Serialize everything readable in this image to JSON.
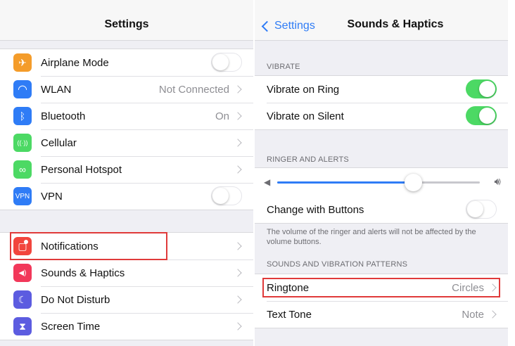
{
  "left": {
    "title": "Settings",
    "group1": [
      {
        "label": "Airplane Mode",
        "icon": "airplane-icon",
        "color": "#f49c2a",
        "accessory": "toggle-off"
      },
      {
        "label": "WLAN",
        "icon": "wifi-icon",
        "color": "#2f7cf6",
        "detail": "Not Connected",
        "accessory": "chevron"
      },
      {
        "label": "Bluetooth",
        "icon": "bluetooth-icon",
        "color": "#2f7cf6",
        "detail": "On",
        "accessory": "chevron"
      },
      {
        "label": "Cellular",
        "icon": "antenna-icon",
        "color": "#4cd964",
        "accessory": "chevron"
      },
      {
        "label": "Personal Hotspot",
        "icon": "hotspot-link-icon",
        "color": "#4cd964",
        "accessory": "chevron"
      },
      {
        "label": "VPN",
        "icon": "vpn-icon",
        "icon_text": "VPN",
        "color": "#2f7cf6",
        "accessory": "toggle-off"
      }
    ],
    "group2": [
      {
        "label": "Notifications",
        "icon": "notifications-icon",
        "color": "#f2453d",
        "accessory": "chevron"
      },
      {
        "label": "Sounds & Haptics",
        "icon": "speaker-icon",
        "color": "#f2385a",
        "accessory": "chevron"
      },
      {
        "label": "Do Not Disturb",
        "icon": "moon-icon",
        "color": "#5c5ce0",
        "accessory": "chevron"
      },
      {
        "label": "Screen Time",
        "icon": "hourglass-icon",
        "color": "#5c5ce0",
        "accessory": "chevron"
      }
    ]
  },
  "right": {
    "back_label": "Settings",
    "title": "Sounds & Haptics",
    "vibrate_header": "VIBRATE",
    "vibrate_on_ring": "Vibrate on Ring",
    "vibrate_on_silent": "Vibrate on Silent",
    "ringer_header": "RINGER AND ALERTS",
    "ringer_volume": 0.67,
    "change_with_buttons": "Change with Buttons",
    "ringer_note": "The volume of the ringer and alerts will not be affected by the volume buttons.",
    "patterns_header": "SOUNDS AND VIBRATION PATTERNS",
    "ringtone_label": "Ringtone",
    "ringtone_value": "Circles",
    "text_tone_label": "Text Tone",
    "text_tone_value": "Note"
  },
  "colors": {
    "accent": "#2f7cf6",
    "toggle_on": "#4cd964",
    "highlight": "#e03a3a"
  }
}
